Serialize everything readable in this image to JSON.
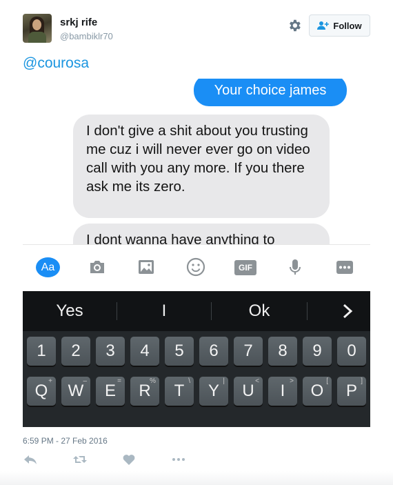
{
  "tweet": {
    "display_name": "srkj rife",
    "handle": "@bambiklr70",
    "follow_label": "Follow",
    "text": "@courosa",
    "timestamp": "6:59 PM - 27 Feb 2016"
  },
  "icons": {
    "settings": "gear-icon",
    "follow": "person-plus-icon",
    "reply": "reply-icon",
    "retweet": "retweet-icon",
    "like": "heart-icon",
    "more": "more-dots-icon"
  },
  "screenshot": {
    "messages": {
      "sent": "Your choice james",
      "received_1": "I don't give a shit about you trusting me cuz i will never ever go on video call with you any more. If you there ask me its zero.",
      "received_2": "I dont wanna have anything to"
    },
    "composer": {
      "aa_label": "Aa",
      "gif_label": "GIF"
    },
    "keyboard": {
      "suggestions": [
        "Yes",
        "I",
        "Ok"
      ],
      "number_row": [
        "1",
        "2",
        "3",
        "4",
        "5",
        "6",
        "7",
        "8",
        "9",
        "0"
      ],
      "letter_row": [
        "Q",
        "W",
        "E",
        "R",
        "T",
        "Y",
        "U",
        "I",
        "O",
        "P"
      ],
      "letter_row_alt": [
        "+",
        "–",
        "=",
        "%",
        "\\",
        "|",
        "<",
        ">",
        "[",
        "]"
      ]
    }
  },
  "colors": {
    "link_blue": "#1b95e0",
    "messenger_blue": "#1a8ef5",
    "bubble_gray": "#e8e8ea"
  }
}
